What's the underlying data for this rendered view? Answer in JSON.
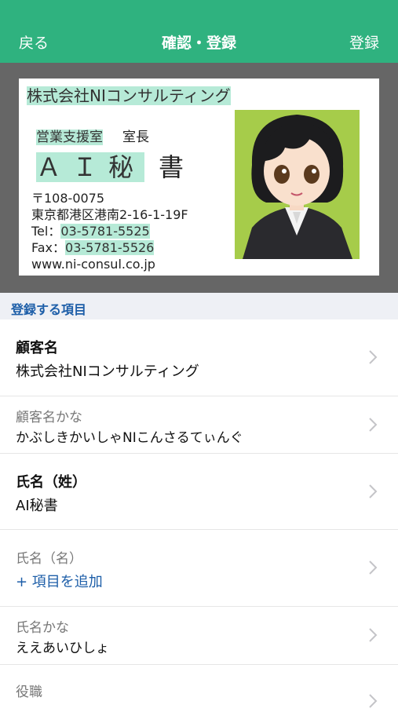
{
  "nav": {
    "back_label": "戻る",
    "title": "確認・登録",
    "register_label": "登録"
  },
  "card": {
    "company": "株式会社NIコンサルティング",
    "department": "営業支援室",
    "position": "室長",
    "name_first": "ＡＩ秘",
    "name_last": "書",
    "postal": "〒108-0075",
    "address": "東京都港区港南2-16-1-19F",
    "tel_label": "Tel：",
    "tel": "03-5781-5525",
    "fax_label": "Fax：",
    "fax": "03-5781-5526",
    "url": "www.ni-consul.co.jp"
  },
  "section": {
    "title": "登録する項目"
  },
  "fields": [
    {
      "label": "顧客名",
      "value": "株式会社NIコンサルティング"
    },
    {
      "label": "顧客名かな",
      "value": "かぶしきかいしゃNIこんさるてぃんぐ"
    },
    {
      "label": "氏名（姓）",
      "value": "AI秘書"
    },
    {
      "label": "氏名（名）",
      "value": "+ 項目を追加"
    },
    {
      "label": "氏名かな",
      "value": "ええあいひしょ"
    },
    {
      "label": "役職",
      "value": ""
    }
  ],
  "colors": {
    "accent": "#2fb27f",
    "link": "#1d5ea8",
    "highlight": "#b6ead7",
    "photo_bg": "#a6cc4a"
  }
}
